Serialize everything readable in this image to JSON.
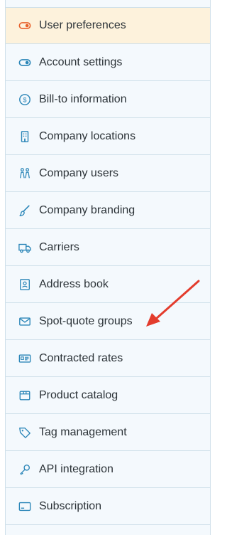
{
  "menu": {
    "items": [
      {
        "label": "User preferences",
        "icon": "toggle-on-icon",
        "active": true
      },
      {
        "label": "Account settings",
        "icon": "toggle-icon"
      },
      {
        "label": "Bill-to information",
        "icon": "dollar-circle-icon"
      },
      {
        "label": "Company locations",
        "icon": "building-icon"
      },
      {
        "label": "Company users",
        "icon": "users-icon"
      },
      {
        "label": "Company branding",
        "icon": "paintbrush-icon"
      },
      {
        "label": "Carriers",
        "icon": "truck-icon"
      },
      {
        "label": "Address book",
        "icon": "contact-book-icon"
      },
      {
        "label": "Spot-quote groups",
        "icon": "envelope-icon"
      },
      {
        "label": "Contracted rates",
        "icon": "id-card-icon"
      },
      {
        "label": "Product catalog",
        "icon": "box-icon"
      },
      {
        "label": "Tag management",
        "icon": "tag-icon"
      },
      {
        "label": "API integration",
        "icon": "key-icon"
      },
      {
        "label": "Subscription",
        "icon": "card-icon"
      }
    ]
  },
  "colors": {
    "icon": "#2b86b8",
    "active_icon": "#e8622c",
    "active_bg": "#fdf2dc",
    "arrow": "#e33c2d"
  }
}
